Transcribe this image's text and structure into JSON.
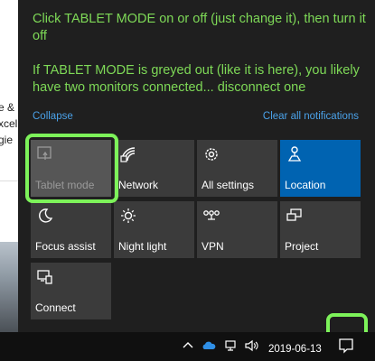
{
  "instructions": {
    "line1": "Click TABLET MODE on or off (just change it), then turn it off",
    "line2": "If TABLET MODE is greyed out (like it is here), you likely have two monitors connected... disconnect one"
  },
  "background_window": {
    "fragments": [
      "e &",
      "xcel",
      "gie"
    ]
  },
  "action_center": {
    "collapse_label": "Collapse",
    "clear_label": "Clear all notifications",
    "tiles": [
      {
        "label": "Tablet mode",
        "icon": "tablet-mode-icon",
        "state": "disabled"
      },
      {
        "label": "Network",
        "icon": "network-icon",
        "state": "normal"
      },
      {
        "label": "All settings",
        "icon": "gear-icon",
        "state": "normal"
      },
      {
        "label": "Location",
        "icon": "location-icon",
        "state": "active"
      },
      {
        "label": "Focus assist",
        "icon": "moon-icon",
        "state": "normal"
      },
      {
        "label": "Night light",
        "icon": "brightness-icon",
        "state": "normal"
      },
      {
        "label": "VPN",
        "icon": "vpn-icon",
        "state": "normal"
      },
      {
        "label": "Project",
        "icon": "project-icon",
        "state": "normal"
      },
      {
        "label": "Connect",
        "icon": "connect-icon",
        "state": "normal"
      }
    ]
  },
  "taskbar": {
    "date": "2019-06-13"
  },
  "colors": {
    "annotation_green": "#7ed957",
    "highlight_green": "#7df35a",
    "link_blue": "#4aa1e8",
    "active_tile": "#0063b1",
    "tile": "#3b3b3b",
    "panel": "#1f1f1f"
  }
}
